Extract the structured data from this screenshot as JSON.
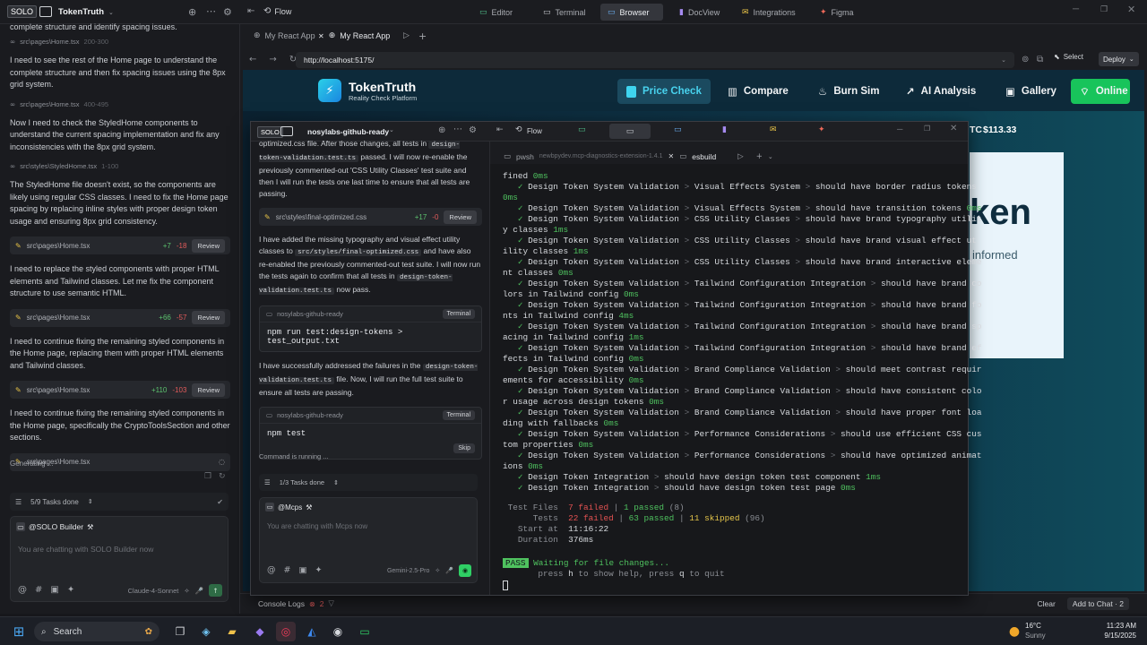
{
  "topbar": {
    "solo": "SOLO",
    "project": "TokenTruth",
    "flow": "Flow",
    "tabs": [
      "Editor",
      "Terminal",
      "Browser",
      "DocView",
      "Integrations",
      "Figma"
    ]
  },
  "left_chat": {
    "top_text": "complete structure and identify spacing issues.",
    "items": [
      {
        "type": "fileref",
        "path": "src\\pages\\Home.tsx",
        "lines": "200-300"
      },
      {
        "type": "msg",
        "text": "I need to see the rest of the Home page to understand the complete structure and then fix spacing issues using the 8px grid system."
      },
      {
        "type": "fileref",
        "path": "src\\pages\\Home.tsx",
        "lines": "400-495"
      },
      {
        "type": "msg",
        "text": "Now I need to check the StyledHome components to understand the current spacing implementation and fix any inconsistencies with the 8px grid system."
      },
      {
        "type": "fileref",
        "path": "src\\styles\\StyledHome.tsx",
        "lines": "1-100"
      },
      {
        "type": "msg",
        "text": "The StyledHome file doesn't exist, so the components are likely using regular CSS classes. I need to fix the Home page spacing by replacing inline styles with proper design token usage and ensuring 8px grid consistency."
      },
      {
        "type": "diff",
        "path": "src\\pages\\Home.tsx",
        "plus": "+7",
        "minus": "-18",
        "action": "Review"
      },
      {
        "type": "msg",
        "text": "I need to replace the styled components with proper HTML elements and Tailwind classes. Let me fix the component structure to use semantic HTML."
      },
      {
        "type": "diff",
        "path": "src\\pages\\Home.tsx",
        "plus": "+66",
        "minus": "-57",
        "action": "Review"
      },
      {
        "type": "msg",
        "text": "I need to continue fixing the remaining styled components in the Home page, replacing them with proper HTML elements and Tailwind classes."
      },
      {
        "type": "diff",
        "path": "src\\pages\\Home.tsx",
        "plus": "+110",
        "minus": "-103",
        "action": "Review"
      },
      {
        "type": "msg",
        "text": "I need to continue fixing the remaining styled components in the Home page, specifically the CryptoToolsSection and other sections."
      },
      {
        "type": "pending",
        "path": "src\\pages\\Home.tsx"
      }
    ],
    "generating": "Generating ...",
    "tasks": "5/9 Tasks done",
    "agent": "@SOLO Builder",
    "placeholder": "You are chatting with SOLO Builder now",
    "model": "Claude-4-Sonnet"
  },
  "browser": {
    "tabs": [
      "My React App",
      "My React App"
    ],
    "url": "http://localhost:5175/",
    "select": "Select",
    "deploy": "Deploy",
    "console": "Console Logs",
    "console_count": "2",
    "clear": "Clear",
    "add_chat": "Add to Chat · 2"
  },
  "site": {
    "brand": "TokenTruth",
    "tagline": "Reality Check Platform",
    "nav": [
      "Price Check",
      "Compare",
      "Burn Sim",
      "AI Analysis",
      "Gallery"
    ],
    "online": "Online",
    "ticker": "TC",
    "price": "$113.33",
    "hero_partial": "ken",
    "hero_sub_partial": "informed"
  },
  "overlay": {
    "solo": "SOLO",
    "project": "nosylabs-github-ready",
    "flow": "Flow",
    "chat_items": [
      {
        "type": "msg_html",
        "parts": [
          {
            "t": "optimized.css"
          },
          {
            "t": " file. After those changes, all tests in "
          },
          {
            "c": "design-token-validation.test.ts"
          },
          {
            "t": " passed. I will now re-enable the previously commented-out 'CSS Utility Classes' test suite and then I will run the tests one last time to ensure that all tests are passing."
          }
        ]
      },
      {
        "type": "diff",
        "path": "src\\styles\\final-optimized.css",
        "plus": "+17",
        "minus": "-0",
        "action": "Review"
      },
      {
        "type": "msg_html",
        "parts": [
          {
            "t": "I have added the missing typography and visual effect utility classes to "
          },
          {
            "c": "src/styles/final-optimized.css"
          },
          {
            "t": " and have also re-enabled the previously commented-out test suite. I will now run the tests again to confirm that all tests in "
          },
          {
            "c": "design-token-validation.test.ts"
          },
          {
            "t": " now pass."
          }
        ]
      },
      {
        "type": "term",
        "project": "nosylabs-github-ready",
        "label": "Terminal",
        "cmd": "npm run test:design-tokens > test_output.txt"
      },
      {
        "type": "msg_html",
        "parts": [
          {
            "t": "I have successfully addressed the failures in the "
          },
          {
            "c": "design-token-validation.test.ts"
          },
          {
            "t": " file. Now, I will run the full test suite to ensure all tests are passing."
          }
        ]
      },
      {
        "type": "term2",
        "project": "nosylabs-github-ready",
        "label": "Terminal",
        "cmd": "npm test",
        "skip": "Skip"
      }
    ],
    "running": "Command is running ...",
    "tasks": "1/3 Tasks done",
    "agent": "@Mcps",
    "placeholder": "You are chatting with Mcps now",
    "model": "Gemini-2.5-Pro",
    "term_tabs": [
      "pwsh",
      "esbuild"
    ],
    "term_path": "newbpydev.mcp-diagnostics-extension-1.4.1",
    "lines": [
      [
        [
          "fined ",
          ""
        ],
        [
          "0ms",
          "g"
        ]
      ],
      [
        [
          "   ✓ ",
          "g"
        ],
        [
          "Design Token System Validation ",
          ""
        ],
        [
          "> ",
          "gr"
        ],
        [
          "Visual Effects System ",
          ""
        ],
        [
          "> ",
          "gr"
        ],
        [
          "should have border radius tokens",
          ""
        ]
      ],
      [
        [
          "0ms",
          "g"
        ]
      ],
      [
        [
          "   ✓ ",
          "g"
        ],
        [
          "Design Token System Validation ",
          ""
        ],
        [
          "> ",
          "gr"
        ],
        [
          "Visual Effects System ",
          ""
        ],
        [
          "> ",
          "gr"
        ],
        [
          "should have transition tokens ",
          ""
        ],
        [
          "0ms",
          "g"
        ]
      ],
      [
        [
          "   ✓ ",
          "g"
        ],
        [
          "Design Token System Validation ",
          ""
        ],
        [
          "> ",
          "gr"
        ],
        [
          "CSS Utility Classes ",
          ""
        ],
        [
          "> ",
          "gr"
        ],
        [
          "should have brand typography utilit",
          ""
        ]
      ],
      [
        [
          "y classes ",
          ""
        ],
        [
          "1ms",
          "g"
        ]
      ],
      [
        [
          "   ✓ ",
          "g"
        ],
        [
          "Design Token System Validation ",
          ""
        ],
        [
          "> ",
          "gr"
        ],
        [
          "CSS Utility Classes ",
          ""
        ],
        [
          "> ",
          "gr"
        ],
        [
          "should have brand visual effect ut",
          ""
        ]
      ],
      [
        [
          "ility classes ",
          ""
        ],
        [
          "1ms",
          "g"
        ]
      ],
      [
        [
          "   ✓ ",
          "g"
        ],
        [
          "Design Token System Validation ",
          ""
        ],
        [
          "> ",
          "gr"
        ],
        [
          "CSS Utility Classes ",
          ""
        ],
        [
          "> ",
          "gr"
        ],
        [
          "should have brand interactive eleme",
          ""
        ]
      ],
      [
        [
          "nt classes ",
          ""
        ],
        [
          "0ms",
          "g"
        ]
      ],
      [
        [
          "   ✓ ",
          "g"
        ],
        [
          "Design Token System Validation ",
          ""
        ],
        [
          "> ",
          "gr"
        ],
        [
          "Tailwind Configuration Integration ",
          ""
        ],
        [
          "> ",
          "gr"
        ],
        [
          "should have brand co",
          ""
        ]
      ],
      [
        [
          "lors in Tailwind config ",
          ""
        ],
        [
          "0ms",
          "g"
        ]
      ],
      [
        [
          "   ✓ ",
          "g"
        ],
        [
          "Design Token System Validation ",
          ""
        ],
        [
          "> ",
          "gr"
        ],
        [
          "Tailwind Configuration Integration ",
          ""
        ],
        [
          "> ",
          "gr"
        ],
        [
          "should have brand fo",
          ""
        ]
      ],
      [
        [
          "nts in Tailwind config ",
          ""
        ],
        [
          "4ms",
          "g"
        ]
      ],
      [
        [
          "   ✓ ",
          "g"
        ],
        [
          "Design Token System Validation ",
          ""
        ],
        [
          "> ",
          "gr"
        ],
        [
          "Tailwind Configuration Integration ",
          ""
        ],
        [
          "> ",
          "gr"
        ],
        [
          "should have brand sp",
          ""
        ]
      ],
      [
        [
          "acing in Tailwind config ",
          ""
        ],
        [
          "1ms",
          "g"
        ]
      ],
      [
        [
          "   ✓ ",
          "g"
        ],
        [
          "Design Token System Validation ",
          ""
        ],
        [
          "> ",
          "gr"
        ],
        [
          "Tailwind Configuration Integration ",
          ""
        ],
        [
          "> ",
          "gr"
        ],
        [
          "should have brand ef",
          ""
        ]
      ],
      [
        [
          "fects in Tailwind config ",
          ""
        ],
        [
          "0ms",
          "g"
        ]
      ],
      [
        [
          "   ✓ ",
          "g"
        ],
        [
          "Design Token System Validation ",
          ""
        ],
        [
          "> ",
          "gr"
        ],
        [
          "Brand Compliance Validation ",
          ""
        ],
        [
          "> ",
          "gr"
        ],
        [
          "should meet contrast requir",
          ""
        ]
      ],
      [
        [
          "ements for accessibility ",
          ""
        ],
        [
          "0ms",
          "g"
        ]
      ],
      [
        [
          "   ✓ ",
          "g"
        ],
        [
          "Design Token System Validation ",
          ""
        ],
        [
          "> ",
          "gr"
        ],
        [
          "Brand Compliance Validation ",
          ""
        ],
        [
          "> ",
          "gr"
        ],
        [
          "should have consistent colo",
          ""
        ]
      ],
      [
        [
          "r usage across design tokens ",
          ""
        ],
        [
          "0ms",
          "g"
        ]
      ],
      [
        [
          "   ✓ ",
          "g"
        ],
        [
          "Design Token System Validation ",
          ""
        ],
        [
          "> ",
          "gr"
        ],
        [
          "Brand Compliance Validation ",
          ""
        ],
        [
          "> ",
          "gr"
        ],
        [
          "should have proper font loa",
          ""
        ]
      ],
      [
        [
          "ding with fallbacks ",
          ""
        ],
        [
          "0ms",
          "g"
        ]
      ],
      [
        [
          "   ✓ ",
          "g"
        ],
        [
          "Design Token System Validation ",
          ""
        ],
        [
          "> ",
          "gr"
        ],
        [
          "Performance Considerations ",
          ""
        ],
        [
          "> ",
          "gr"
        ],
        [
          "should use efficient CSS cus",
          ""
        ]
      ],
      [
        [
          "tom properties ",
          ""
        ],
        [
          "0ms",
          "g"
        ]
      ],
      [
        [
          "   ✓ ",
          "g"
        ],
        [
          "Design Token System Validation ",
          ""
        ],
        [
          "> ",
          "gr"
        ],
        [
          "Performance Considerations ",
          ""
        ],
        [
          "> ",
          "gr"
        ],
        [
          "should have optimized animat",
          ""
        ]
      ],
      [
        [
          "ions ",
          ""
        ],
        [
          "0ms",
          "g"
        ]
      ],
      [
        [
          "   ✓ ",
          "g"
        ],
        [
          "Design Token Integration ",
          ""
        ],
        [
          "> ",
          "gr"
        ],
        [
          "should have design token test component ",
          ""
        ],
        [
          "1ms",
          "g"
        ]
      ],
      [
        [
          "   ✓ ",
          "g"
        ],
        [
          "Design Token Integration ",
          ""
        ],
        [
          "> ",
          "gr"
        ],
        [
          "should have design token test page ",
          ""
        ],
        [
          "0ms",
          "g"
        ]
      ]
    ],
    "summary": [
      [
        [
          " Test Files  ",
          "d"
        ],
        [
          "7 failed",
          "r"
        ],
        [
          " | ",
          "d"
        ],
        [
          "1 passed",
          "g"
        ],
        [
          " (8)",
          "d"
        ]
      ],
      [
        [
          "      Tests  ",
          "d"
        ],
        [
          "22 failed",
          "r"
        ],
        [
          " | ",
          "d"
        ],
        [
          "63 passed",
          "g"
        ],
        [
          " | ",
          "d"
        ],
        [
          "11 skipped",
          "y"
        ],
        [
          " (96)",
          "d"
        ]
      ],
      [
        [
          "   Start at  ",
          "d"
        ],
        [
          "11:16:22",
          ""
        ]
      ],
      [
        [
          "   Duration  ",
          "d"
        ],
        [
          "376ms",
          ""
        ]
      ]
    ],
    "pass_badge": "PASS",
    "waiting": " Waiting for file changes...",
    "help_line": [
      [
        "       press ",
        "d"
      ],
      [
        "h",
        ""
      ],
      [
        " to show help, press ",
        "d"
      ],
      [
        "q",
        ""
      ],
      [
        " to quit",
        "d"
      ]
    ]
  },
  "taskbar": {
    "search": "Search",
    "weather_temp": "16°C",
    "weather_desc": "Sunny",
    "time": "11:23 AM",
    "date": "9/15/2025"
  }
}
